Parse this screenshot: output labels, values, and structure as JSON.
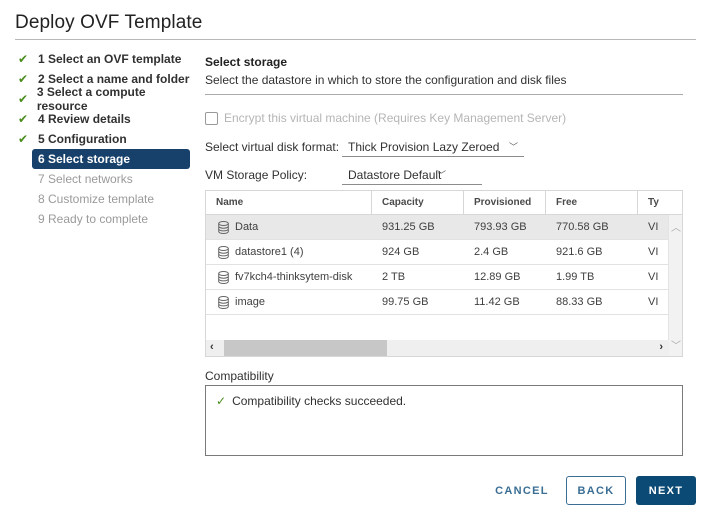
{
  "window": {
    "title": "Deploy OVF Template"
  },
  "steps": [
    {
      "label": "1 Select an OVF template",
      "state": "done"
    },
    {
      "label": "2 Select a name and folder",
      "state": "done"
    },
    {
      "label": "3 Select a compute resource",
      "state": "done"
    },
    {
      "label": "4 Review details",
      "state": "done"
    },
    {
      "label": "5 Configuration",
      "state": "done"
    },
    {
      "label": "6 Select storage",
      "state": "active"
    },
    {
      "label": "7 Select networks",
      "state": "future"
    },
    {
      "label": "8 Customize template",
      "state": "future"
    },
    {
      "label": "9 Ready to complete",
      "state": "future"
    }
  ],
  "section": {
    "title": "Select storage",
    "description": "Select the datastore in which to store the configuration and disk files"
  },
  "encrypt": {
    "label": "Encrypt this virtual machine (Requires Key Management Server)",
    "checked": false,
    "disabled": true
  },
  "disk_format": {
    "label": "Select virtual disk format:",
    "value": "Thick Provision Lazy Zeroed"
  },
  "storage_policy": {
    "label": "VM Storage Policy:",
    "value": "Datastore Default"
  },
  "grid": {
    "columns": [
      "Name",
      "Capacity",
      "Provisioned",
      "Free",
      "Ty"
    ],
    "rows": [
      {
        "name": "Data",
        "capacity": "931.25 GB",
        "provisioned": "793.93 GB",
        "free": "770.58 GB",
        "type": "VI",
        "selected": true
      },
      {
        "name": "datastore1 (4)",
        "capacity": "924 GB",
        "provisioned": "2.4 GB",
        "free": "921.6 GB",
        "type": "VI",
        "selected": false
      },
      {
        "name": "fv7kch4-thinksytem-disk",
        "capacity": "2 TB",
        "provisioned": "12.89 GB",
        "free": "1.99 TB",
        "type": "VI",
        "selected": false
      },
      {
        "name": "image",
        "capacity": "99.75 GB",
        "provisioned": "11.42 GB",
        "free": "88.33 GB",
        "type": "VI",
        "selected": false
      }
    ]
  },
  "compatibility": {
    "label": "Compatibility",
    "message": "Compatibility checks succeeded."
  },
  "buttons": {
    "cancel": "CANCEL",
    "back": "BACK",
    "next": "NEXT"
  },
  "colors": {
    "accent": "#17416b",
    "primary_button": "#0b4a74",
    "success": "#4a8c1c"
  }
}
